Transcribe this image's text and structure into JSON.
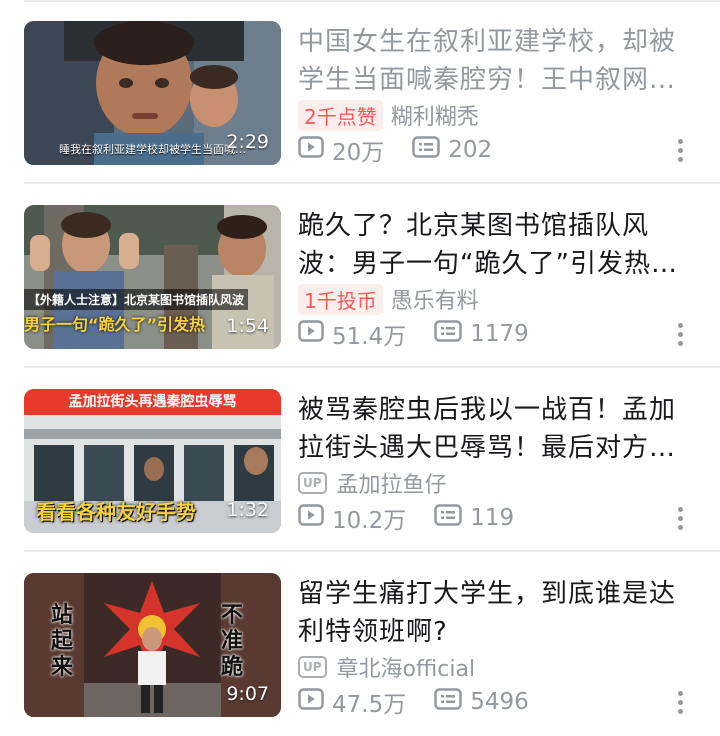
{
  "colors": {
    "title": "#18191c",
    "title_grey": "#9499a0",
    "meta": "#9499a0",
    "badge_bg": "#fdeeee",
    "badge_text": "#f85a54",
    "divider": "#ededed"
  },
  "icons": {
    "play": "play-count-icon",
    "danmaku": "danmaku-icon",
    "up": "up-icon",
    "more": "more-icon"
  },
  "videos": [
    {
      "title": "中国女生在叙利亚建学校，却被学生当面喊秦腔穷！王中叙网…",
      "badge": "2千点赞",
      "author": "糊利糊秃",
      "duration": "2:29",
      "views": "20万",
      "danmaku": "202",
      "thumb_caption": "睡我在叙利亚建学校却被学生当面喊…"
    },
    {
      "title": "跪久了？北京某图书馆插队风波：男子一句“跪久了”引发热…",
      "badge": "1千投币",
      "author": "愚乐有料",
      "duration": "1:54",
      "views": "51.4万",
      "danmaku": "1179",
      "thumb_tag": "【外籍人士注意】北京某图书馆插队风波",
      "thumb_caption": "男子一句“跪久了”引发热"
    },
    {
      "title": "被骂秦腔虫后我以一战百！孟加拉街头遇大巴辱骂！最后对方…",
      "up_label": "UP",
      "author": "孟加拉鱼仔",
      "duration": "1:32",
      "views": "10.2万",
      "danmaku": "119",
      "thumb_banner": "孟加拉街头再遇秦腔虫辱骂",
      "thumb_caption": "看看各种友好手势"
    },
    {
      "title": "留学生痛打大学生，到底谁是达利特领班啊?",
      "up_label": "UP",
      "author": "章北海official",
      "duration": "9:07",
      "views": "47.5万",
      "danmaku": "5496",
      "thumb_left": "站起来",
      "thumb_right": "不准跪"
    }
  ]
}
